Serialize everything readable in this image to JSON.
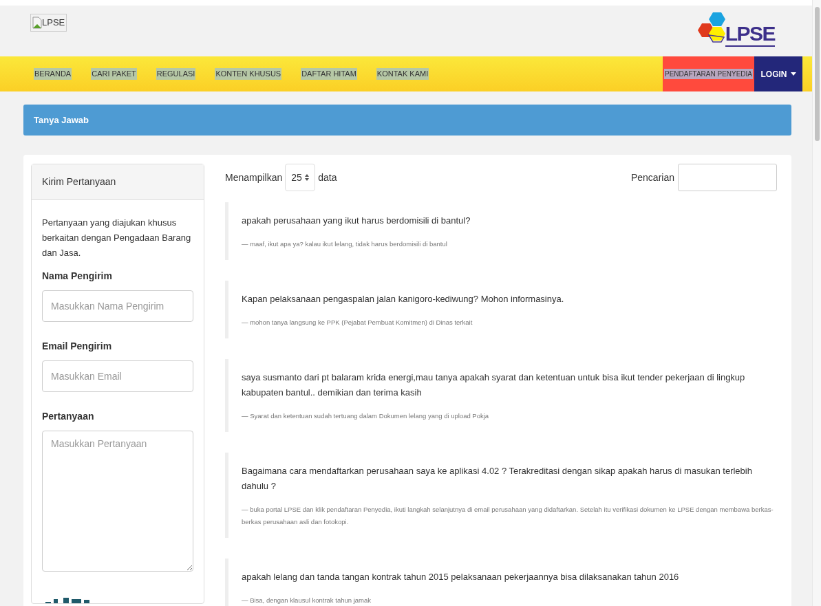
{
  "header": {
    "logo_alt": "LPSE",
    "brand": "LPSE"
  },
  "nav": {
    "items": [
      {
        "label": "BERANDA"
      },
      {
        "label": "CARI PAKET"
      },
      {
        "label": "REGULASI"
      },
      {
        "label": "KONTEN KHUSUS"
      },
      {
        "label": "DAFTAR HITAM"
      },
      {
        "label": "KONTAK KAMI"
      }
    ],
    "register": "PENDAFTARAN PENYEDIA",
    "login": "LOGIN"
  },
  "page_title": "Tanya Jawab",
  "form": {
    "title": "Kirim Pertanyaan",
    "intro": "Pertanyaan yang diajukan khusus berkaitan dengan Pengadaan Barang dan Jasa.",
    "fields": [
      {
        "kind": "input",
        "label": "Nama Pengirim",
        "placeholder": "Masukkan Nama Pengirim"
      },
      {
        "kind": "input",
        "label": "Email Pengirim",
        "placeholder": "Masukkan Email"
      },
      {
        "kind": "textarea",
        "label": "Pertanyaan",
        "placeholder": "Masukkan Pertanyaan"
      }
    ]
  },
  "list": {
    "show_label": "Menampilkan",
    "page_size": "25",
    "show_suffix": "data",
    "search_label": "Pencarian",
    "items": [
      {
        "question": "apakah perusahaan yang ikut harus berdomisili di bantul?",
        "answer": "— maaf, ikut apa ya? kalau ikut lelang, tidak harus berdomisili di bantul"
      },
      {
        "question": "Kapan pelaksanaan pengaspalan jalan kanigoro-kediwung? Mohon informasinya.",
        "answer": "— mohon tanya langsung ke PPK (Pejabat Pembuat Komitmen) di Dinas terkait"
      },
      {
        "question": "saya susmanto dari pt balaram krida energi,mau tanya apakah syarat dan ketentuan untuk bisa ikut tender pekerjaan di lingkup kabupaten bantul.. demikian dan terima kasih",
        "answer": "— Syarat dan ketentuan sudah tertuang dalam Dokumen lelang yang di upload Pokja"
      },
      {
        "question": "Bagaimana cara mendaftarkan perusahaan saya ke aplikasi 4.02 ? Terakreditasi dengan sikap apakah harus di masukan terlebih dahulu ?",
        "answer": "— buka portal LPSE dan klik pendaftaran Penyedia, ikuti langkah selanjutnya di email perusahaan yang didaftarkan. Setelah itu verifikasi dokumen ke LPSE dengan membawa berkas-berkas perusahaan asli dan fotokopi."
      },
      {
        "question": "apakah lelang dan tanda tangan kontrak tahun 2015 pelaksanaan pekerjaannya bisa dilaksanakan tahun 2016",
        "answer": "— Bisa, dengan klausul kontrak tahun jamak"
      }
    ]
  }
}
